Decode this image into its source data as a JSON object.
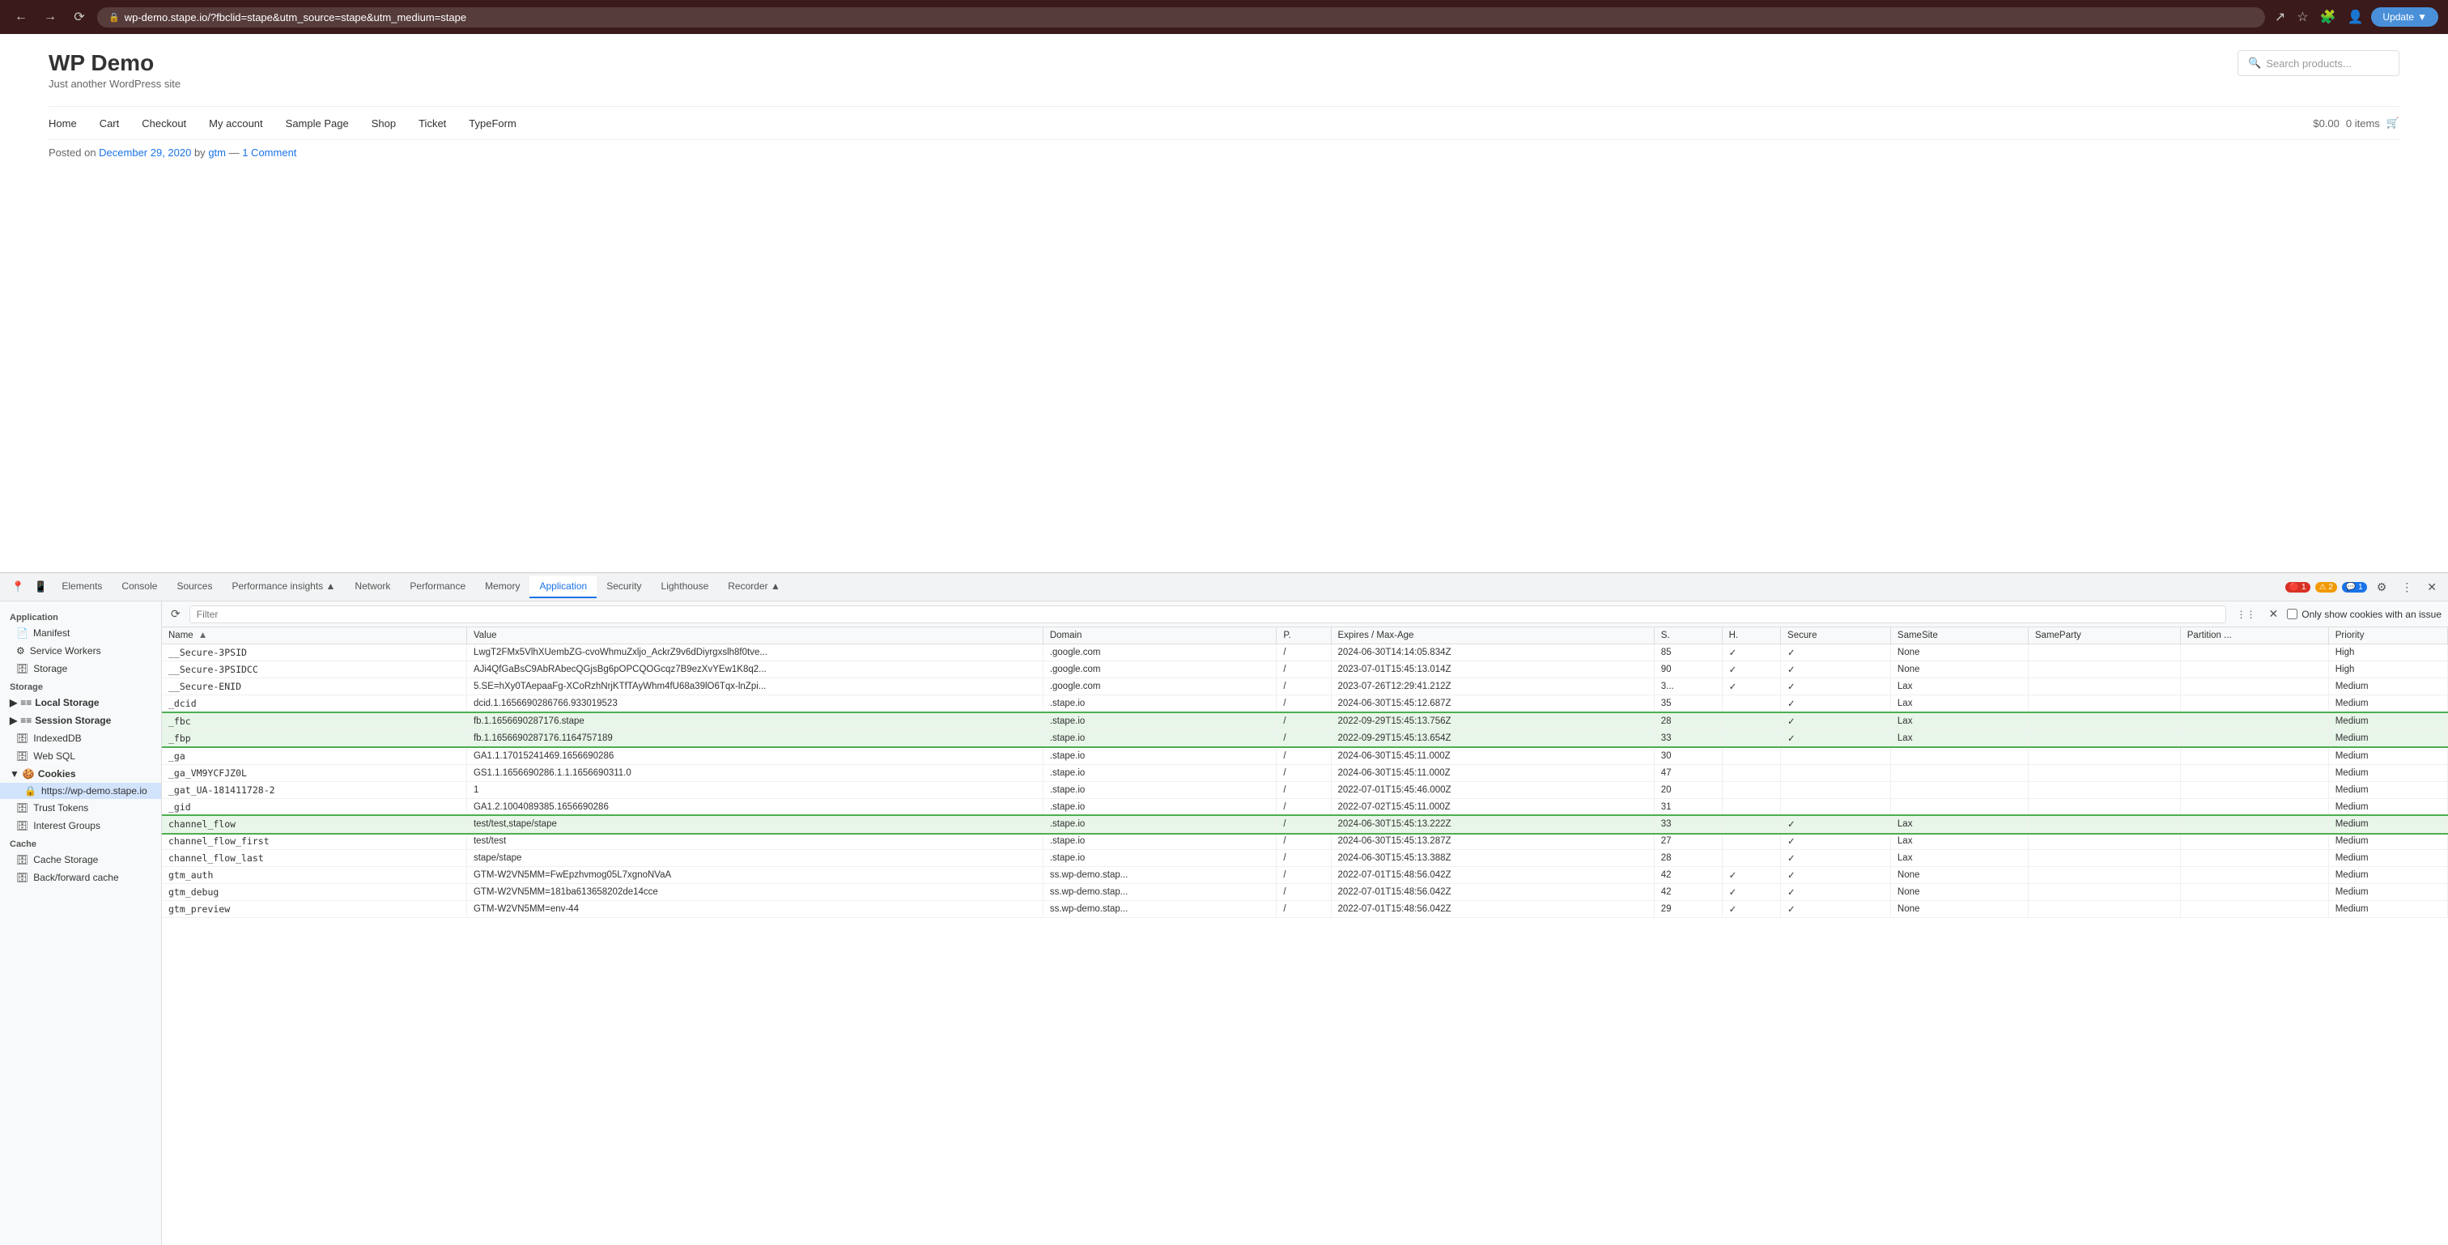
{
  "browser": {
    "url": "wp-demo.stape.io/?fbclid=stape&utm_source=stape&utm_medium=stape",
    "update_label": "Update"
  },
  "page": {
    "title": "WP Demo",
    "subtitle": "Just another WordPress site",
    "search_placeholder": "Search products...",
    "nav_links": [
      "Home",
      "Cart",
      "Checkout",
      "My account",
      "Sample Page",
      "Shop",
      "Ticket",
      "TypeForm"
    ],
    "cart_price": "$0.00",
    "cart_items": "0 items",
    "post_info": "Posted on December 29, 2020 by gtm — 1 Comment"
  },
  "devtools": {
    "tabs": [
      "Elements",
      "Console",
      "Sources",
      "Performance insights",
      "Network",
      "Performance",
      "Memory",
      "Application",
      "Security",
      "Lighthouse",
      "Recorder"
    ],
    "active_tab": "Application",
    "badges": {
      "error": "1",
      "warning": "2",
      "info": "1"
    }
  },
  "sidebar": {
    "sections": [
      {
        "label": "Application",
        "items": [
          {
            "name": "Manifest",
            "icon": "📄",
            "type": "item"
          },
          {
            "name": "Service Workers",
            "icon": "⚙",
            "type": "item"
          },
          {
            "name": "Storage",
            "icon": "🗄",
            "type": "item"
          }
        ]
      },
      {
        "label": "Storage",
        "items": [
          {
            "name": "Local Storage",
            "icon": "≡",
            "type": "group",
            "expanded": true
          },
          {
            "name": "Session Storage",
            "icon": "≡",
            "type": "group",
            "expanded": false
          },
          {
            "name": "IndexedDB",
            "icon": "🗄",
            "type": "item"
          },
          {
            "name": "Web SQL",
            "icon": "🗄",
            "type": "item"
          },
          {
            "name": "Cookies",
            "icon": "🍪",
            "type": "group",
            "expanded": true
          },
          {
            "name": "https://wp-demo.stape.io",
            "icon": "🔒",
            "type": "sub",
            "active": true
          },
          {
            "name": "Trust Tokens",
            "icon": "🗄",
            "type": "item"
          },
          {
            "name": "Interest Groups",
            "icon": "🗄",
            "type": "item"
          }
        ]
      },
      {
        "label": "Cache",
        "items": [
          {
            "name": "Cache Storage",
            "icon": "🗄",
            "type": "item"
          },
          {
            "name": "Back/forward cache",
            "icon": "🗄",
            "type": "item"
          }
        ]
      }
    ]
  },
  "cookies_panel": {
    "filter_placeholder": "Filter",
    "only_issues_label": "Only show cookies with an issue",
    "columns": [
      "Name",
      "Value",
      "Domain",
      "P.",
      "Expires / Max-Age",
      "S.",
      "H.",
      "Secure",
      "SameSite",
      "SameParty",
      "Partition ...",
      "Priority"
    ],
    "cookies": [
      {
        "name": "__Secure-3PSID",
        "value": "LwgT2FMx5VlhXUembZG-cvoWhmuZxljo_AckrZ9v6dDiyrgxslh8f0tve...",
        "domain": ".google.com",
        "path": "/",
        "expires": "2024-06-30T14:14:05.834Z",
        "size": "85",
        "httponly": "✓",
        "secure": "✓",
        "samesite": "None",
        "sameparty": "",
        "partition": "",
        "priority": "High",
        "highlighted": false
      },
      {
        "name": "__Secure-3PSIDCC",
        "value": "AJi4QfGaBsC9AbRAbecQGjsBg6pOPCQOGcqz7B9ezXvYEw1K8q2...",
        "domain": ".google.com",
        "path": "/",
        "expires": "2023-07-01T15:45:13.014Z",
        "size": "90",
        "httponly": "✓",
        "secure": "✓",
        "samesite": "None",
        "sameparty": "",
        "partition": "",
        "priority": "High",
        "highlighted": false
      },
      {
        "name": "__Secure-ENID",
        "value": "5.SE=hXy0TAepaaFg-XCoRzhNrjKTfTAyWhm4fU68a39lO6Tqx-lnZpi...",
        "domain": ".google.com",
        "path": "/",
        "expires": "2023-07-26T12:29:41.212Z",
        "size": "3...",
        "httponly": "✓",
        "secure": "✓",
        "samesite": "Lax",
        "sameparty": "",
        "partition": "",
        "priority": "Medium",
        "highlighted": false
      },
      {
        "name": "_dcid",
        "value": "dcid.1.1656690286766.933019523",
        "domain": ".stape.io",
        "path": "/",
        "expires": "2024-06-30T15:45:12.687Z",
        "size": "35",
        "httponly": "",
        "secure": "✓",
        "samesite": "Lax",
        "sameparty": "",
        "partition": "",
        "priority": "Medium",
        "highlighted": false
      },
      {
        "name": "_fbc",
        "value": "fb.1.1656690287176.stape",
        "domain": ".stape.io",
        "path": "/",
        "expires": "2022-09-29T15:45:13.756Z",
        "size": "28",
        "httponly": "",
        "secure": "✓",
        "samesite": "Lax",
        "sameparty": "",
        "partition": "",
        "priority": "Medium",
        "highlighted": true,
        "highlight_group": "top"
      },
      {
        "name": "_fbp",
        "value": "fb.1.1656690287176.1164757189",
        "domain": ".stape.io",
        "path": "/",
        "expires": "2022-09-29T15:45:13.654Z",
        "size": "33",
        "httponly": "",
        "secure": "✓",
        "samesite": "Lax",
        "sameparty": "",
        "partition": "",
        "priority": "Medium",
        "highlighted": true,
        "highlight_group": "bottom"
      },
      {
        "name": "_ga",
        "value": "GA1.1.17015241469.1656690286",
        "domain": ".stape.io",
        "path": "/",
        "expires": "2024-06-30T15:45:11.000Z",
        "size": "30",
        "httponly": "",
        "secure": "",
        "samesite": "",
        "sameparty": "",
        "partition": "",
        "priority": "Medium",
        "highlighted": false
      },
      {
        "name": "_ga_VM9YCFJZ0L",
        "value": "GS1.1.1656690286.1.1.1656690311.0",
        "domain": ".stape.io",
        "path": "/",
        "expires": "2024-06-30T15:45:11.000Z",
        "size": "47",
        "httponly": "",
        "secure": "",
        "samesite": "",
        "sameparty": "",
        "partition": "",
        "priority": "Medium",
        "highlighted": false
      },
      {
        "name": "_gat_UA-181411728-2",
        "value": "1",
        "domain": ".stape.io",
        "path": "/",
        "expires": "2022-07-01T15:45:46.000Z",
        "size": "20",
        "httponly": "",
        "secure": "",
        "samesite": "",
        "sameparty": "",
        "partition": "",
        "priority": "Medium",
        "highlighted": false
      },
      {
        "name": "_gid",
        "value": "GA1.2.1004089385.1656690286",
        "domain": ".stape.io",
        "path": "/",
        "expires": "2022-07-02T15:45:11.000Z",
        "size": "31",
        "httponly": "",
        "secure": "",
        "samesite": "",
        "sameparty": "",
        "partition": "",
        "priority": "Medium",
        "highlighted": false
      },
      {
        "name": "channel_flow",
        "value": "test/test,stape/stape",
        "domain": ".stape.io",
        "path": "/",
        "expires": "2024-06-30T15:45:13.222Z",
        "size": "33",
        "httponly": "",
        "secure": "✓",
        "samesite": "Lax",
        "sameparty": "",
        "partition": "",
        "priority": "Medium",
        "highlighted": true,
        "highlight_group": "single"
      },
      {
        "name": "channel_flow_first",
        "value": "test/test",
        "domain": ".stape.io",
        "path": "/",
        "expires": "2024-06-30T15:45:13.287Z",
        "size": "27",
        "httponly": "",
        "secure": "✓",
        "samesite": "Lax",
        "sameparty": "",
        "partition": "",
        "priority": "Medium",
        "highlighted": false
      },
      {
        "name": "channel_flow_last",
        "value": "stape/stape",
        "domain": ".stape.io",
        "path": "/",
        "expires": "2024-06-30T15:45:13.388Z",
        "size": "28",
        "httponly": "",
        "secure": "✓",
        "samesite": "Lax",
        "sameparty": "",
        "partition": "",
        "priority": "Medium",
        "highlighted": false
      },
      {
        "name": "gtm_auth",
        "value": "GTM-W2VN5MM=FwEpzhvmog05L7xgnoNVaA",
        "domain": "ss.wp-demo.stap...",
        "path": "/",
        "expires": "2022-07-01T15:48:56.042Z",
        "size": "42",
        "httponly": "✓",
        "secure": "✓",
        "samesite": "None",
        "sameparty": "",
        "partition": "",
        "priority": "Medium",
        "highlighted": false
      },
      {
        "name": "gtm_debug",
        "value": "GTM-W2VN5MM=181ba613658202de14cce",
        "domain": "ss.wp-demo.stap...",
        "path": "/",
        "expires": "2022-07-01T15:48:56.042Z",
        "size": "42",
        "httponly": "✓",
        "secure": "✓",
        "samesite": "None",
        "sameparty": "",
        "partition": "",
        "priority": "Medium",
        "highlighted": false
      },
      {
        "name": "gtm_preview",
        "value": "GTM-W2VN5MM=env-44",
        "domain": "ss.wp-demo.stap...",
        "path": "/",
        "expires": "2022-07-01T15:48:56.042Z",
        "size": "29",
        "httponly": "✓",
        "secure": "✓",
        "samesite": "None",
        "sameparty": "",
        "partition": "",
        "priority": "Medium",
        "highlighted": false
      }
    ]
  }
}
